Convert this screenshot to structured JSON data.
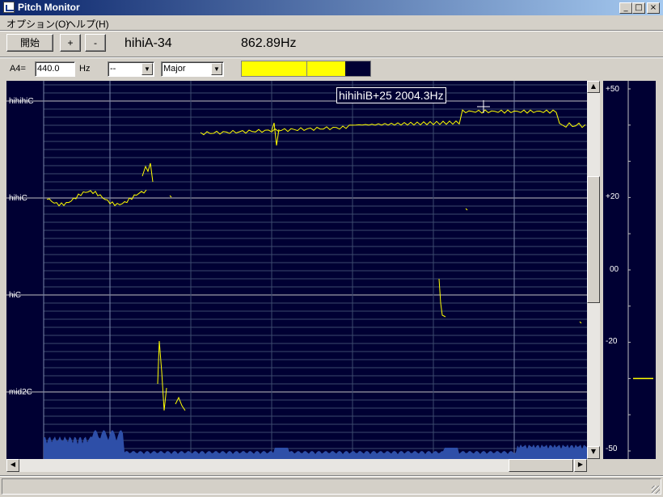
{
  "window": {
    "title": "Pitch Monitor",
    "minimize": "_",
    "maximize": "□",
    "close": "×"
  },
  "menu": [
    "オプション(O)",
    "ヘルプ(H)"
  ],
  "toolbar": {
    "start_label": "開始",
    "plus_label": "+",
    "minus_label": "-",
    "current_note": "hihiA-34",
    "current_freq": "862.89Hz"
  },
  "settings": {
    "a4_label": "A4=",
    "a4_value": "440.0",
    "hz_label": "Hz",
    "key_value": "--",
    "scale_value": "Major"
  },
  "level_meter": {
    "level": 0.75,
    "color": "#ffff00"
  },
  "graph": {
    "note_labels": [
      "hihihiC",
      "hihiC",
      "hiC",
      "mid2C"
    ],
    "tooltip": "hihihiB+25  2004.3Hz",
    "trace_color": "#ffff00",
    "spectrum_color": "#2e4fa8"
  },
  "cents_meter": {
    "labels": [
      "+50",
      "+20",
      "00",
      "-20",
      "-50"
    ],
    "needle_cents": -30
  },
  "colors": {
    "background": "#000033",
    "grid": "#3c4a6e",
    "major_grid": "#c0c0c0"
  }
}
